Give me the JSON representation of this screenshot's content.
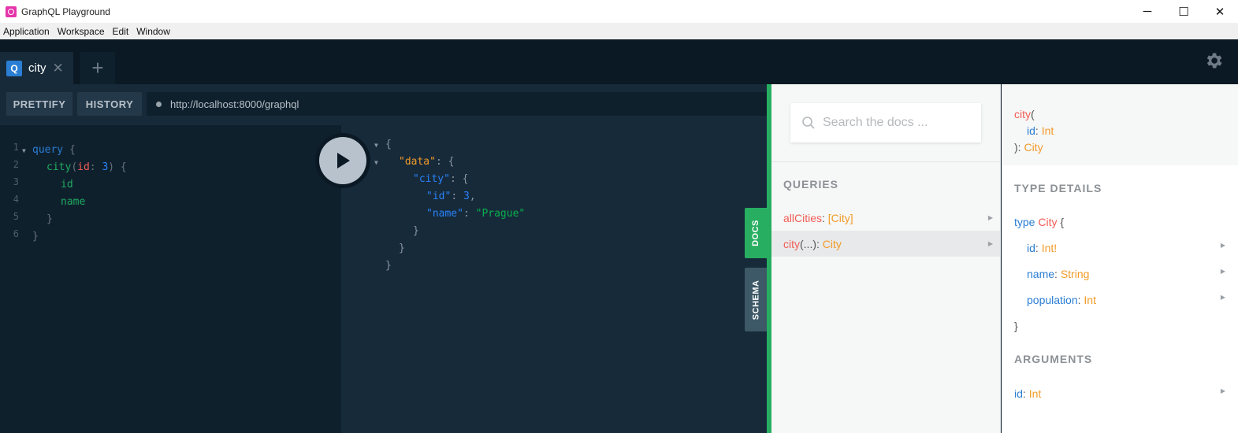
{
  "window": {
    "title": "GraphQL Playground",
    "controls": [
      "─",
      "☐",
      "✕"
    ]
  },
  "menu": [
    "Application",
    "Workspace",
    "Edit",
    "Window"
  ],
  "tabs": [
    {
      "badge": "Q",
      "label": "city",
      "close": "✕"
    }
  ],
  "tab_add": "+",
  "toolbar": {
    "prettify": "PRETTIFY",
    "history": "HISTORY",
    "endpoint": "http://localhost:8000/graphql"
  },
  "query_editor": {
    "line_numbers": [
      "1",
      "2",
      "3",
      "4",
      "5",
      "6"
    ],
    "lines": [
      {
        "t1": "query",
        "t2": " {"
      },
      {
        "fn": "city",
        "p1": "(",
        "arg": "id",
        "p2": ": ",
        "num": "3",
        "p3": ") {"
      },
      {
        "fld": "id"
      },
      {
        "fld": "name"
      },
      {
        "brace": "}"
      },
      {
        "brace": "}"
      }
    ]
  },
  "result": {
    "lines": [
      {
        "brace": "{"
      },
      {
        "key": "\"data\"",
        "rest": ": {"
      },
      {
        "key": "\"city\"",
        "rest": ": {"
      },
      {
        "key": "\"id\"",
        "sep": ": ",
        "num": "3",
        "rest": ","
      },
      {
        "key": "\"name\"",
        "sep": ": ",
        "str": "\"Prague\""
      },
      {
        "brace": "}"
      },
      {
        "brace": "}"
      },
      {
        "brace": "}"
      }
    ]
  },
  "side_tabs": {
    "docs": "DOCS",
    "schema": "SCHEMA"
  },
  "docs": {
    "search_placeholder": "Search the docs ...",
    "queries_title": "QUERIES",
    "queries": [
      {
        "name": "allCities",
        "sep": ": ",
        "type": "[City]",
        "args": ""
      },
      {
        "name": "city",
        "sep": ": ",
        "type": "City",
        "args": "(...)"
      }
    ],
    "detail": {
      "sig_name": "city",
      "sig_open": "(",
      "sig_arg": "id",
      "sig_arg_type": "Int",
      "sig_close": "): ",
      "sig_type": "City",
      "type_details_title": "TYPE DETAILS",
      "type_kw": "type",
      "type_name": "City",
      "type_open": " {",
      "fields": [
        {
          "name": "id",
          "type": "Int!"
        },
        {
          "name": "name",
          "type": "String"
        },
        {
          "name": "population",
          "type": "Int"
        }
      ],
      "type_close": "}",
      "arguments_title": "ARGUMENTS",
      "arguments": [
        {
          "name": "id",
          "type": "Int"
        }
      ]
    }
  },
  "colors": {
    "accent_green": "#27ae60",
    "keyword_blue": "#2a7ed3",
    "name_red": "#f25c54",
    "type_orange": "#f29b29",
    "string_green": "#09b04c"
  }
}
